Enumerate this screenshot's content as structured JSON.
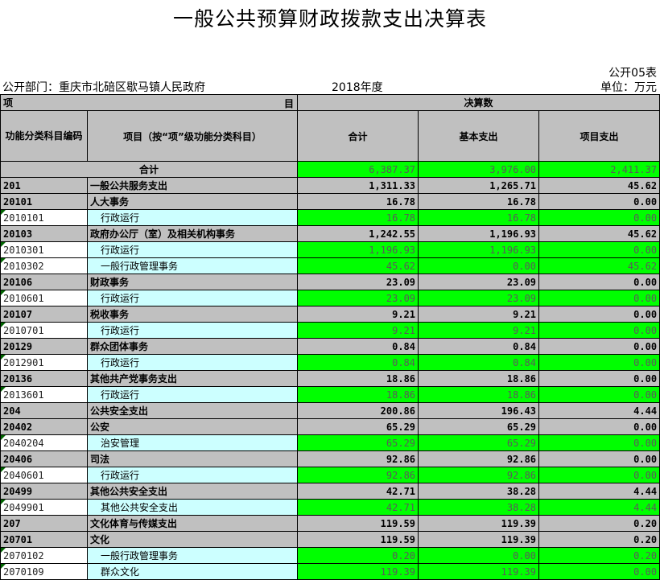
{
  "title": "一般公共预算财政拨款支出决算表",
  "form_no": "公开05表",
  "org": "公开部门：重庆市北碚区歇马镇人民政府",
  "year": "2018年度",
  "unit": "单位：万元",
  "header": {
    "proj_left": "项",
    "proj_right": "目",
    "final_accounts": "决算数",
    "code_col": "功能分类科目编码",
    "name_col": "项目（按“项”级功能分类科目）",
    "total_col": "合计",
    "basic_col": "基本支出",
    "project_col": "项目支出"
  },
  "summary": {
    "label": "合计",
    "total": "6,387.37",
    "basic": "3,976.00",
    "project": "2,411.37"
  },
  "rows": [
    {
      "code": "201",
      "name": "一般公共服务支出",
      "total": "1,311.33",
      "basic": "1,265.71",
      "project": "45.62",
      "leaf": false
    },
    {
      "code": "20101",
      "name": "人大事务",
      "total": "16.78",
      "basic": "16.78",
      "project": "0.00",
      "leaf": false
    },
    {
      "code": "2010101",
      "name": "行政运行",
      "total": "16.78",
      "basic": "16.78",
      "project": "0.00",
      "leaf": true
    },
    {
      "code": "20103",
      "name": "政府办公厅（室）及相关机构事务",
      "total": "1,242.55",
      "basic": "1,196.93",
      "project": "45.62",
      "leaf": false
    },
    {
      "code": "2010301",
      "name": "行政运行",
      "total": "1,196.93",
      "basic": "1,196.93",
      "project": "0.00",
      "leaf": true
    },
    {
      "code": "2010302",
      "name": "一般行政管理事务",
      "total": "45.62",
      "basic": "0.00",
      "project": "45.62",
      "leaf": true
    },
    {
      "code": "20106",
      "name": "财政事务",
      "total": "23.09",
      "basic": "23.09",
      "project": "0.00",
      "leaf": false
    },
    {
      "code": "2010601",
      "name": "行政运行",
      "total": "23.09",
      "basic": "23.09",
      "project": "0.00",
      "leaf": true
    },
    {
      "code": "20107",
      "name": "税收事务",
      "total": "9.21",
      "basic": "9.21",
      "project": "0.00",
      "leaf": false
    },
    {
      "code": "2010701",
      "name": "行政运行",
      "total": "9.21",
      "basic": "9.21",
      "project": "0.00",
      "leaf": true
    },
    {
      "code": "20129",
      "name": "群众团体事务",
      "total": "0.84",
      "basic": "0.84",
      "project": "0.00",
      "leaf": false
    },
    {
      "code": "2012901",
      "name": "行政运行",
      "total": "0.84",
      "basic": "0.84",
      "project": "0.00",
      "leaf": true
    },
    {
      "code": "20136",
      "name": "其他共产党事务支出",
      "total": "18.86",
      "basic": "18.86",
      "project": "0.00",
      "leaf": false
    },
    {
      "code": "2013601",
      "name": "行政运行",
      "total": "18.86",
      "basic": "18.86",
      "project": "0.00",
      "leaf": true
    },
    {
      "code": "204",
      "name": "公共安全支出",
      "total": "200.86",
      "basic": "196.43",
      "project": "4.44",
      "leaf": false
    },
    {
      "code": "20402",
      "name": "公安",
      "total": "65.29",
      "basic": "65.29",
      "project": "0.00",
      "leaf": false
    },
    {
      "code": "2040204",
      "name": "治安管理",
      "total": "65.29",
      "basic": "65.29",
      "project": "0.00",
      "leaf": true
    },
    {
      "code": "20406",
      "name": "司法",
      "total": "92.86",
      "basic": "92.86",
      "project": "0.00",
      "leaf": false
    },
    {
      "code": "2040601",
      "name": "行政运行",
      "total": "92.86",
      "basic": "92.86",
      "project": "0.00",
      "leaf": true
    },
    {
      "code": "20499",
      "name": "其他公共安全支出",
      "total": "42.71",
      "basic": "38.28",
      "project": "4.44",
      "leaf": false
    },
    {
      "code": "2049901",
      "name": "其他公共安全支出",
      "total": "42.71",
      "basic": "38.28",
      "project": "4.44",
      "leaf": true
    },
    {
      "code": "207",
      "name": "文化体育与传媒支出",
      "total": "119.59",
      "basic": "119.39",
      "project": "0.20",
      "leaf": false
    },
    {
      "code": "20701",
      "name": "文化",
      "total": "119.59",
      "basic": "119.39",
      "project": "0.20",
      "leaf": false
    },
    {
      "code": "2070102",
      "name": "一般行政管理事务",
      "total": "0.20",
      "basic": "0.00",
      "project": "0.20",
      "leaf": true
    },
    {
      "code": "2070109",
      "name": "群众文化",
      "total": "119.39",
      "basic": "119.39",
      "project": "0.00",
      "leaf": true
    }
  ],
  "colors": {
    "header_gray": "#c0c0c0",
    "value_green": "#00ff00",
    "name_cyan": "#ccffff"
  }
}
